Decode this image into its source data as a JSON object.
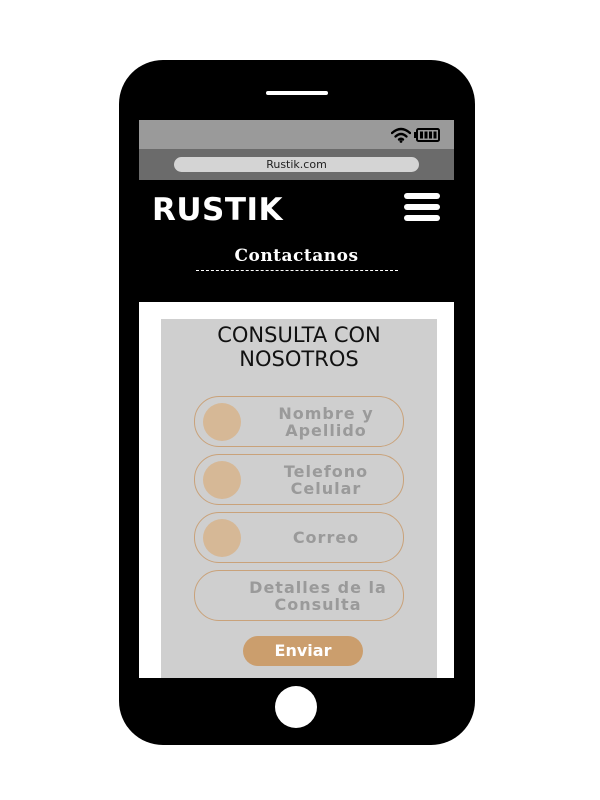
{
  "browser": {
    "url": "Rustik.com",
    "status_icons": [
      "wifi-icon",
      "battery-icon"
    ]
  },
  "header": {
    "brand": "RUSTIK",
    "menu_icon": "hamburger-menu-icon",
    "section_title": "Contactanos",
    "divider": "---------------------------"
  },
  "form": {
    "title_line1": "CONSULTA CON",
    "title_line2": "NOSOTROS",
    "fields": [
      {
        "line1": "Nombre y",
        "line2": "Apellido"
      },
      {
        "line1": "Telefono",
        "line2": "Celular"
      },
      {
        "line1": "Correo",
        "line2": ""
      },
      {
        "line1": "Detalles de la",
        "line2": "Consulta"
      }
    ],
    "submit_label": "Enviar"
  },
  "colors": {
    "phone_body": "#000000",
    "status_bar": "#9a9a9a",
    "address_bar": "#6b6b6b",
    "card_bg": "#cfcfcf",
    "accent": "#cb9e6d",
    "field_dot": "#d6b896"
  }
}
